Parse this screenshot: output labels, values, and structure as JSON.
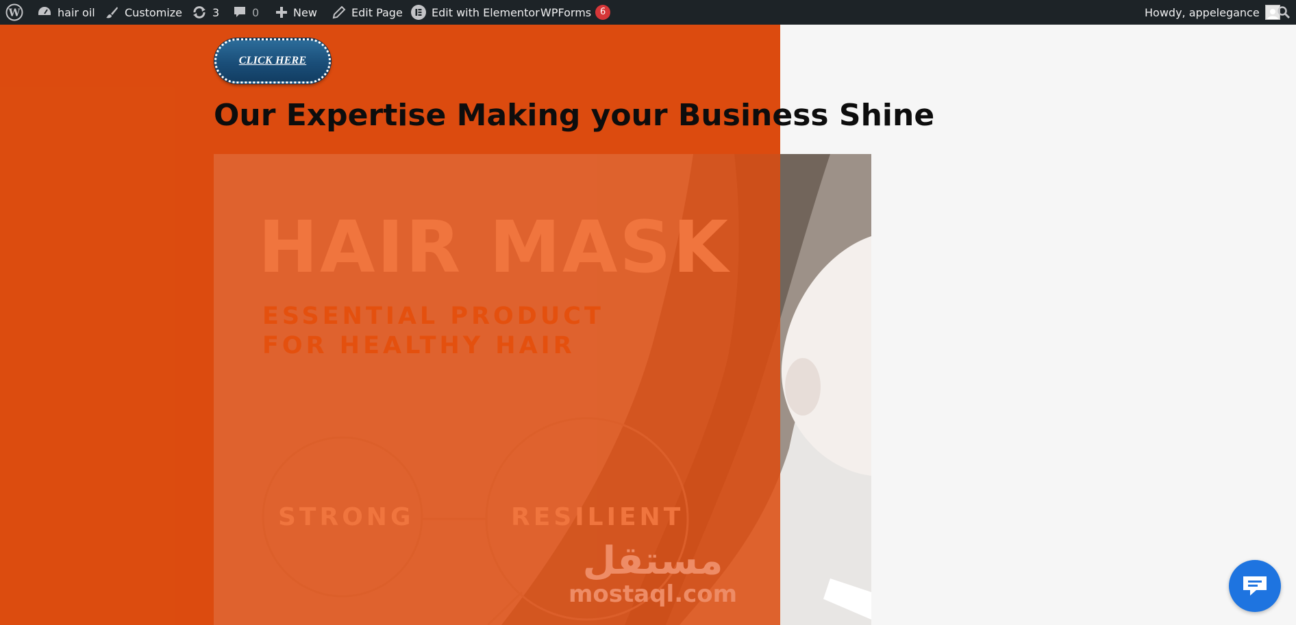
{
  "adminbar": {
    "site_name": "hair oil",
    "customize": "Customize",
    "updates_count": "3",
    "comments_count": "0",
    "new": "New",
    "edit_page": "Edit Page",
    "edit_elementor": "Edit with Elementor",
    "wpforms": "WPForms",
    "wpforms_badge": "6",
    "greeting": "Howdy, appelegance"
  },
  "content": {
    "button_label": "CLICK HERE",
    "heading": "Our Expertise Making your Business Shine"
  },
  "image": {
    "title": "HAIR MASK",
    "subtitle_line1": "ESSENTIAL PRODUCT",
    "subtitle_line2": "FOR HEALTHY HAIR",
    "circle_left": "STRONG",
    "circle_right": "RESILIENT"
  },
  "watermark": {
    "arabic": "مستقل",
    "domain": "mostaql.com"
  },
  "colors": {
    "admin_bar": "#1d2327",
    "orange_bg": "#dc4c0f",
    "button_blue": "#1a4e79",
    "chat_blue": "#1e74e0",
    "badge_red": "#d63638"
  },
  "icons": {
    "wp_logo": "wordpress-icon",
    "dashboard": "dashboard-icon",
    "customize": "paintbrush-icon",
    "updates": "refresh-icon",
    "comments": "comment-icon",
    "new": "plus-icon",
    "edit": "pencil-icon",
    "elementor": "elementor-icon",
    "search": "search-icon",
    "chat": "chat-icon"
  }
}
